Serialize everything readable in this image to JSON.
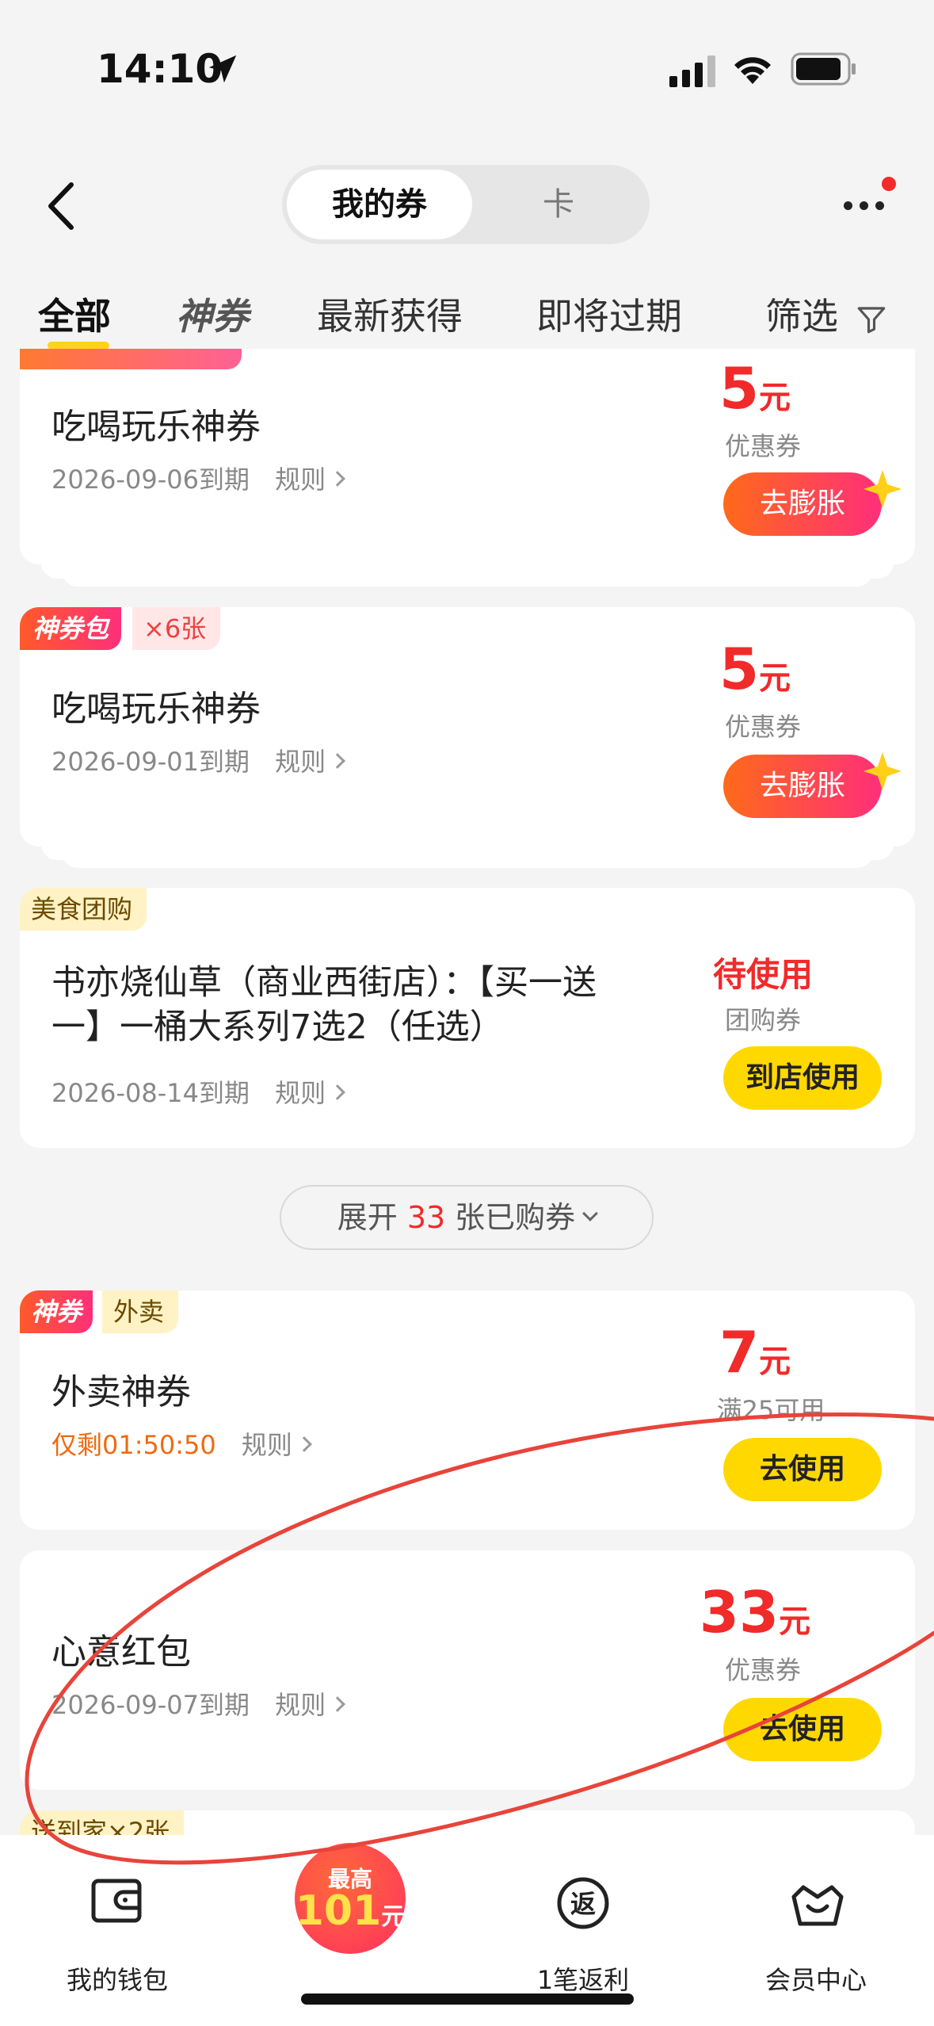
{
  "status_bar": {
    "time": "14:10"
  },
  "header": {
    "segments": [
      {
        "label": "我的券",
        "active": true
      },
      {
        "label": "卡",
        "active": false
      }
    ]
  },
  "tabs": [
    {
      "label": "全部",
      "active": true
    },
    {
      "label": "神券",
      "active": false
    },
    {
      "label": "最新获得",
      "active": false
    },
    {
      "label": "即将过期",
      "active": false
    },
    {
      "label": "筛选",
      "active": false
    }
  ],
  "coupons": [
    {
      "title": "吃喝玩乐神券",
      "expiry": "2026-09-06到期",
      "rule": "规则",
      "amount": "5",
      "unit": "元",
      "subtitle": "优惠券",
      "action": "去膨胀"
    },
    {
      "badge": "神券包",
      "badge_count": "×6张",
      "title": "吃喝玩乐神券",
      "expiry": "2026-09-01到期",
      "rule": "规则",
      "amount": "5",
      "unit": "元",
      "subtitle": "优惠券",
      "action": "去膨胀"
    },
    {
      "badge": "美食团购",
      "title_line1": "书亦烧仙草（商业西街店）：【买一送",
      "title_line2": "一】一桶大系列7选2（任选）",
      "expiry": "2026-08-14到期",
      "rule": "规则",
      "status": "待使用",
      "subtitle": "团购券",
      "action": "到店使用"
    },
    {
      "badge": "神券",
      "badge2": "外卖",
      "title": "外卖神券",
      "countdown": "仅剩01:50:50",
      "rule": "规则",
      "amount": "7",
      "unit": "元",
      "subtitle": "满25可用",
      "action": "去使用"
    },
    {
      "title": "心意红包",
      "expiry": "2026-09-07到期",
      "rule": "规则",
      "amount": "33",
      "unit": "元",
      "subtitle": "优惠券",
      "action": "去使用"
    },
    {
      "badge": "送到家×2张"
    }
  ],
  "expand": {
    "prefix": "展开",
    "count": "33",
    "suffix": "张已购券"
  },
  "bottom_nav": {
    "items": [
      {
        "label": "我的钱包"
      },
      {
        "label": "1笔返利"
      },
      {
        "label": "会员中心"
      }
    ],
    "promo": {
      "top": "最高",
      "amount": "101",
      "unit": "元"
    },
    "rebate_icon_glyph": "返"
  },
  "colors": {
    "accent_red": "#f12a2a",
    "accent_yellow": "#ffd800",
    "annotation_red": "#e8443a"
  }
}
